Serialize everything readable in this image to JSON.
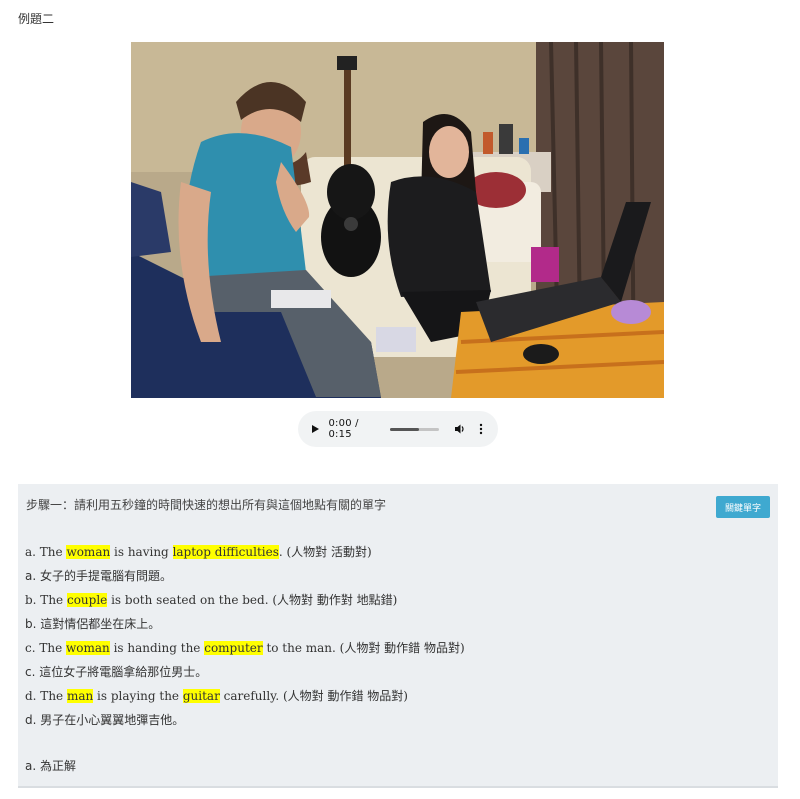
{
  "page": {
    "title": "例題二"
  },
  "audio": {
    "time": "0:00 / 0:15",
    "progress": 0.6
  },
  "panel": {
    "step": "步驟一：請利用五秒鐘的時間快速的想出所有與這個地點有關的單字",
    "key_button": "關鍵單字",
    "options": [
      {
        "segs": [
          {
            "t": "a. The ",
            "h": false
          },
          {
            "t": "woman",
            "h": true
          },
          {
            "t": " is having ",
            "h": false
          },
          {
            "t": "laptop difficulties",
            "h": true
          },
          {
            "t": ". (人物對 活動對)",
            "h": false
          }
        ]
      },
      {
        "segs": [
          {
            "t": "a. 女子的手提電腦有問題。",
            "h": false
          }
        ]
      },
      {
        "segs": [
          {
            "t": "b. The ",
            "h": false
          },
          {
            "t": "couple",
            "h": true
          },
          {
            "t": " is both seated on the bed. (人物對 動作對 地點錯)",
            "h": false
          }
        ]
      },
      {
        "segs": [
          {
            "t": "b. 這對情侶都坐在床上。",
            "h": false
          }
        ]
      },
      {
        "segs": [
          {
            "t": "c. The ",
            "h": false
          },
          {
            "t": "woman",
            "h": true
          },
          {
            "t": " is handing the ",
            "h": false
          },
          {
            "t": "computer",
            "h": true
          },
          {
            "t": " to the man. (人物對 動作錯 物品對)",
            "h": false
          }
        ]
      },
      {
        "segs": [
          {
            "t": "c. 這位女子將電腦拿給那位男士。",
            "h": false
          }
        ]
      },
      {
        "segs": [
          {
            "t": "d. The ",
            "h": false
          },
          {
            "t": "man",
            "h": true
          },
          {
            "t": " is playing the ",
            "h": false
          },
          {
            "t": "guitar",
            "h": true
          },
          {
            "t": " carefully. (人物對 動作錯 物品對)",
            "h": false
          }
        ]
      },
      {
        "segs": [
          {
            "t": "d. 男子在小心翼翼地彈吉他。",
            "h": false
          }
        ]
      }
    ],
    "answer": "a. 為正解"
  },
  "colors": {
    "highlight": "#ffff00",
    "button": "#3fa9d0",
    "panel": "#eceff2"
  }
}
